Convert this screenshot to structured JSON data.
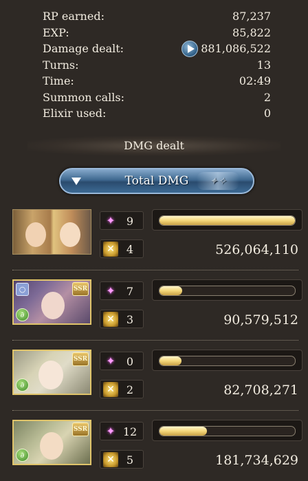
{
  "stats": [
    {
      "label": "RP earned:",
      "value": "87,237"
    },
    {
      "label": "EXP:",
      "value": "85,822"
    },
    {
      "label": "Damage dealt:",
      "value": "881,086,522",
      "icon": "play-icon"
    },
    {
      "label": "Turns:",
      "value": "13"
    },
    {
      "label": "Time:",
      "value": "02:49"
    },
    {
      "label": "Summon calls:",
      "value": "2"
    },
    {
      "label": "Elixir used:",
      "value": "0"
    }
  ],
  "dmg_header": "DMG dealt",
  "total_button": {
    "label": "Total DMG",
    "icon": "triangle-down-icon"
  },
  "characters": [
    {
      "skills": "9",
      "charge_attacks": "4",
      "damage": "526,064,110",
      "gauge_fraction": 1.0,
      "ssr": false,
      "portrait": "main-character-portrait"
    },
    {
      "skills": "7",
      "charge_attacks": "3",
      "damage": "90,579,512",
      "gauge_fraction": 0.17,
      "ssr": true,
      "portrait": "character-portrait"
    },
    {
      "skills": "0",
      "charge_attacks": "2",
      "damage": "82,708,271",
      "gauge_fraction": 0.16,
      "ssr": true,
      "portrait": "character-portrait"
    },
    {
      "skills": "12",
      "charge_attacks": "5",
      "damage": "181,734,629",
      "gauge_fraction": 0.35,
      "ssr": true,
      "portrait": "character-portrait"
    }
  ],
  "badges": {
    "ssr": "SSR"
  },
  "colors": {
    "background": "#2e2925",
    "gauge": "#f4d77a",
    "button": "#3f6990"
  }
}
